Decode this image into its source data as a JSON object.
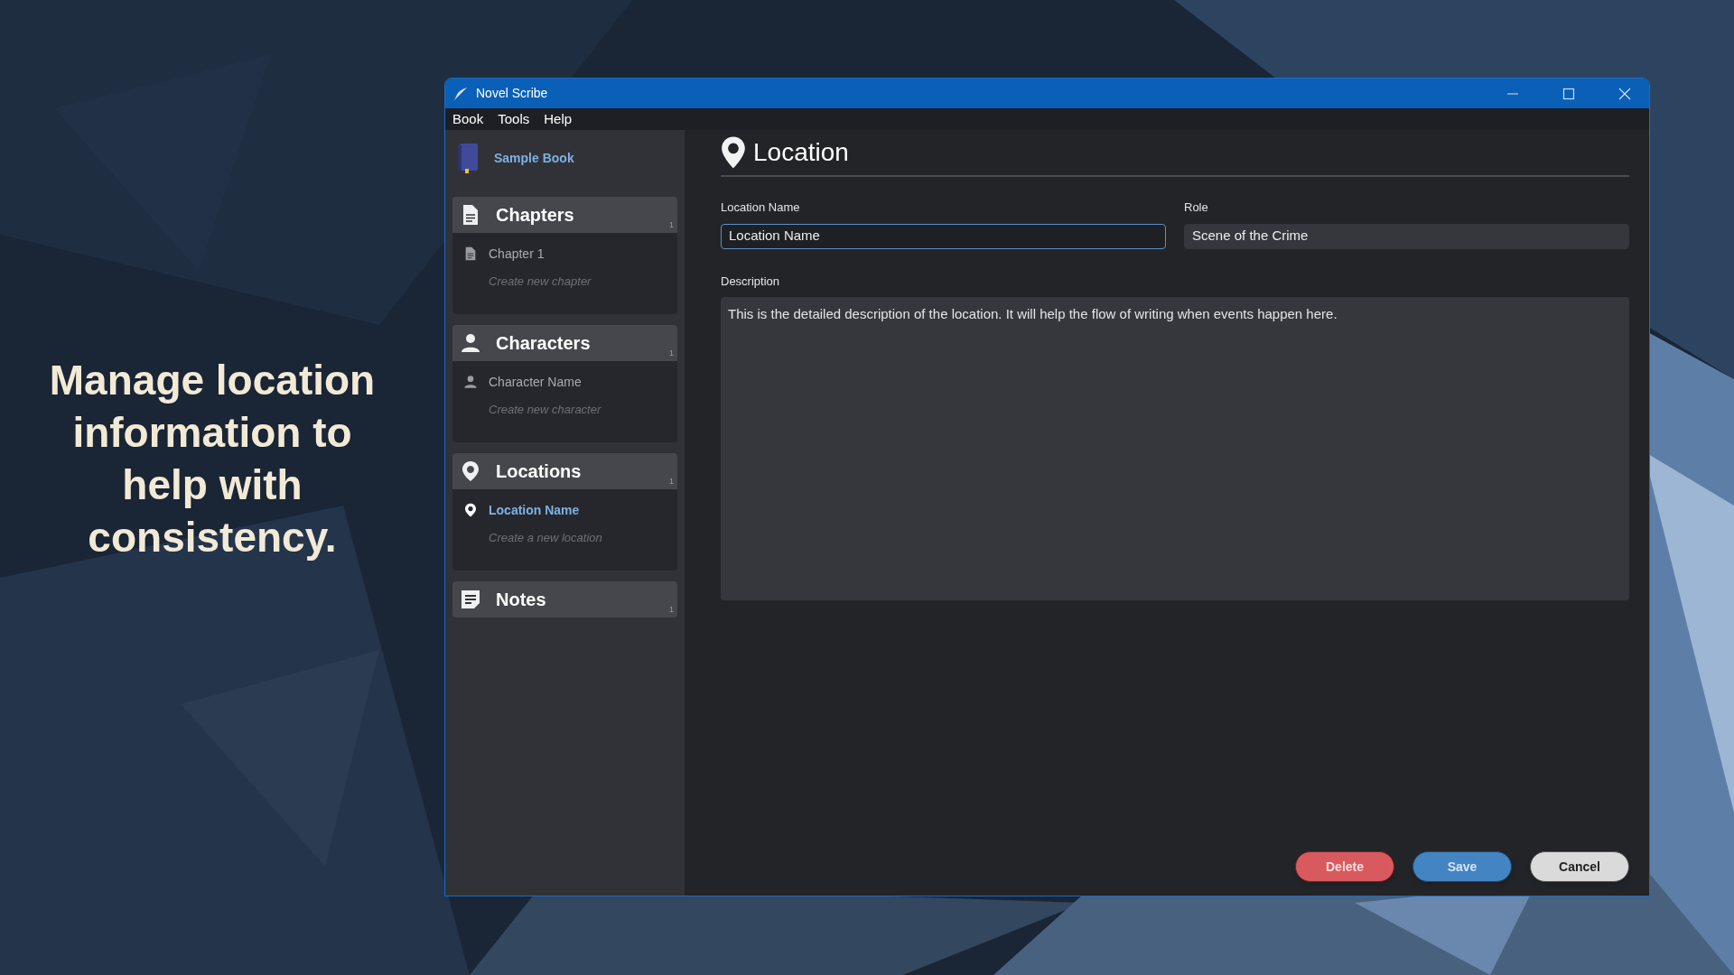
{
  "slide": {
    "caption": "Manage location information to help with consistency."
  },
  "window": {
    "title": "Novel Scribe"
  },
  "menu": [
    "Book",
    "Tools",
    "Help"
  ],
  "sidebar": {
    "book": "Sample Book",
    "sections": [
      {
        "kind": "chapter",
        "title": "Chapters",
        "count": "1",
        "items": [
          {
            "label": "Chapter 1",
            "selected": false
          }
        ],
        "create": "Create new chapter"
      },
      {
        "kind": "character",
        "title": "Characters",
        "count": "1",
        "items": [
          {
            "label": "Character Name",
            "selected": false
          }
        ],
        "create": "Create new character"
      },
      {
        "kind": "location",
        "title": "Locations",
        "count": "1",
        "items": [
          {
            "label": "Location Name",
            "selected": true
          }
        ],
        "create": "Create a new location"
      },
      {
        "kind": "note",
        "title": "Notes",
        "count": "1"
      }
    ]
  },
  "form": {
    "heading": "Location",
    "fields": [
      {
        "label": "Location Name",
        "value": "Location Name",
        "focused": true
      },
      {
        "label": "Role",
        "value": "Scene of the Crime",
        "focused": false
      }
    ],
    "description": {
      "label": "Description",
      "value": "This is the detailed description of the location. It will help the flow of writing when events happen here."
    }
  },
  "buttons": [
    {
      "label": "Delete",
      "kind": "danger"
    },
    {
      "label": "Save",
      "kind": "primary"
    },
    {
      "label": "Cancel",
      "kind": "secondary"
    }
  ]
}
